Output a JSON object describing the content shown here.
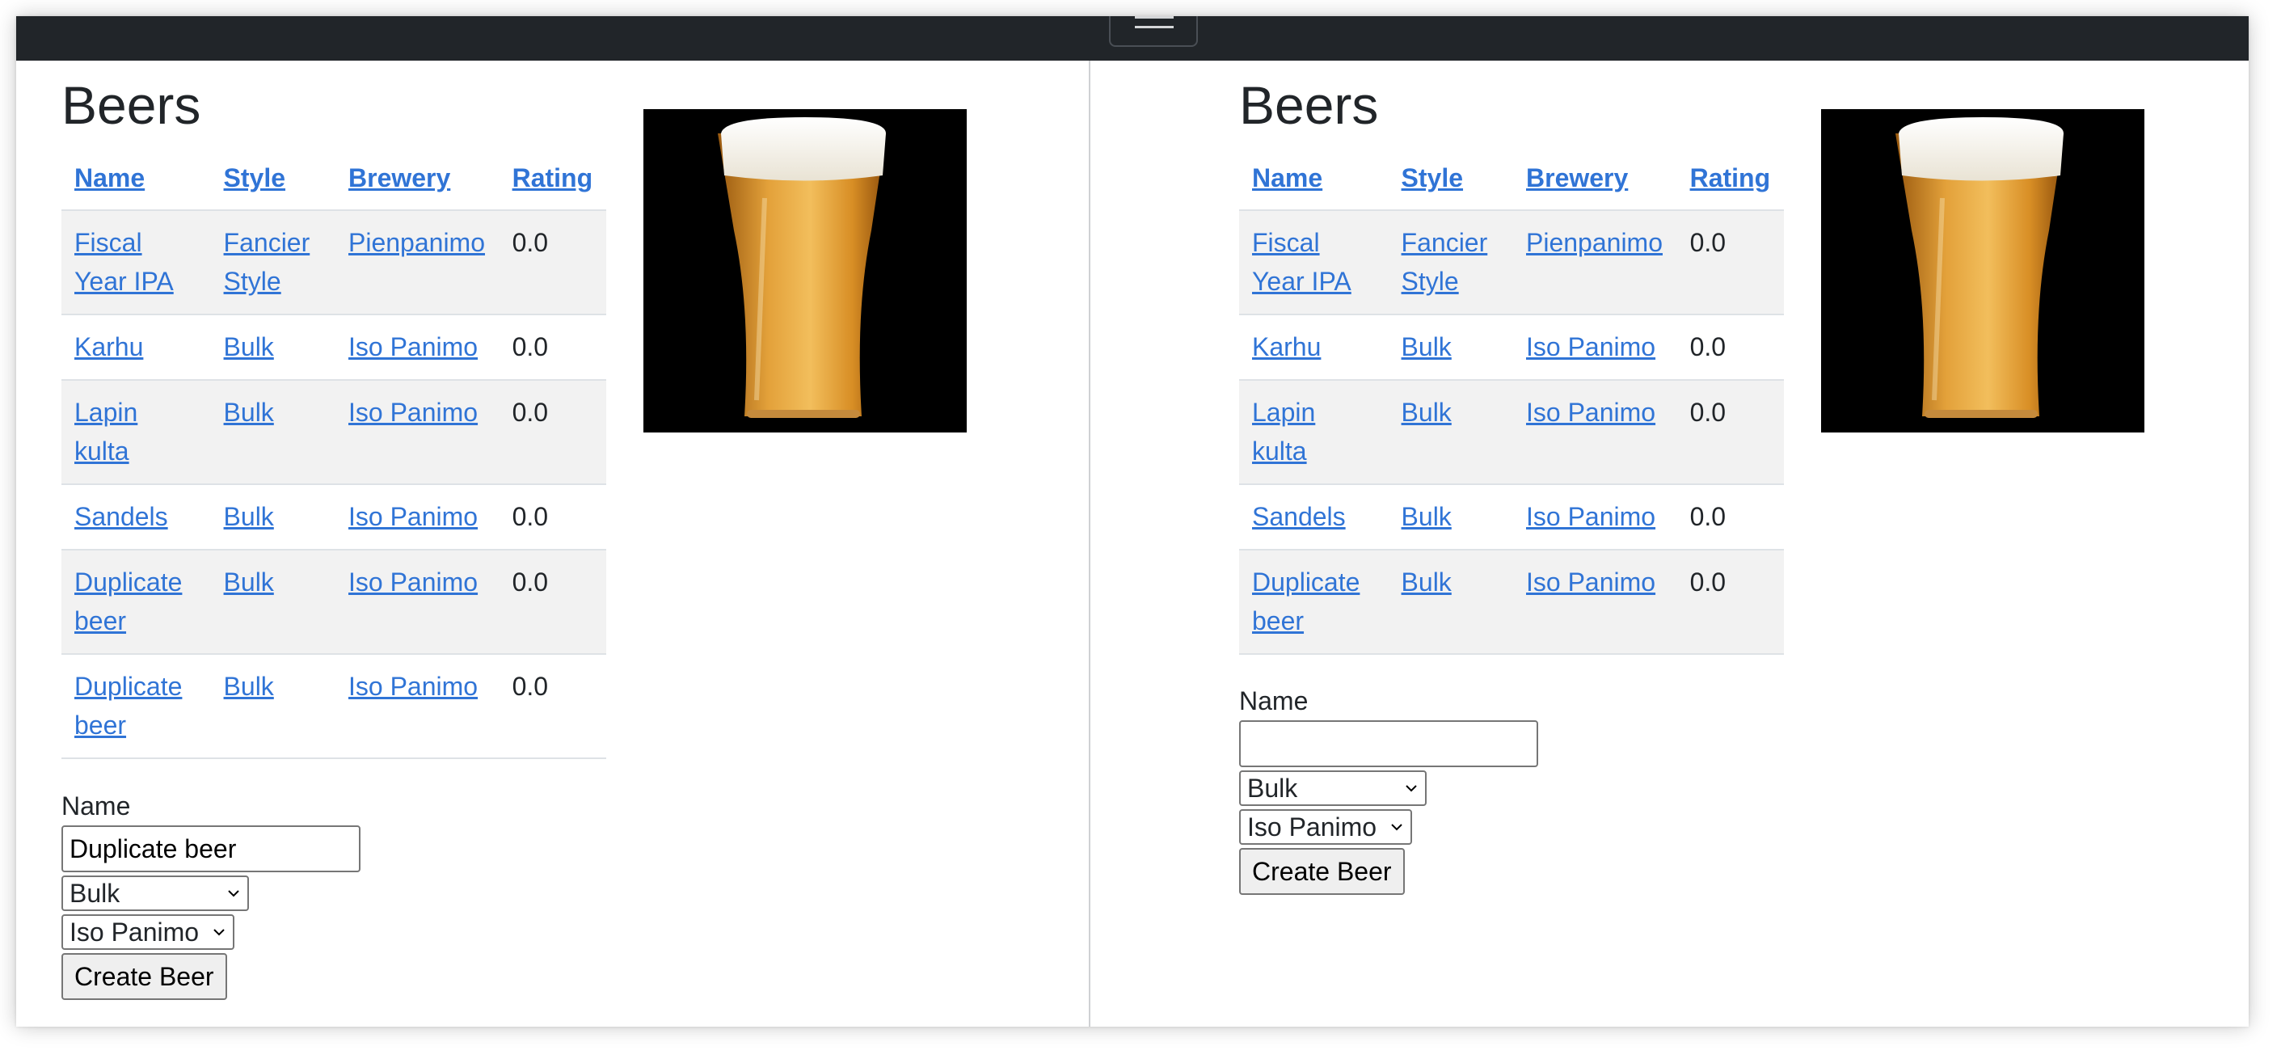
{
  "heading": "Beers",
  "table": {
    "columns": [
      "Name",
      "Style",
      "Brewery",
      "Rating"
    ],
    "rows": [
      {
        "name": "Fiscal Year IPA",
        "style": "Fancier Style",
        "brewery": "Pienpanimo",
        "rating": "0.0"
      },
      {
        "name": "Karhu",
        "style": "Bulk",
        "brewery": "Iso Panimo",
        "rating": "0.0"
      },
      {
        "name": "Lapin kulta",
        "style": "Bulk",
        "brewery": "Iso Panimo",
        "rating": "0.0"
      },
      {
        "name": "Sandels",
        "style": "Bulk",
        "brewery": "Iso Panimo",
        "rating": "0.0"
      },
      {
        "name": "Duplicate beer",
        "style": "Bulk",
        "brewery": "Iso Panimo",
        "rating": "0.0"
      },
      {
        "name": "Duplicate beer",
        "style": "Bulk",
        "brewery": "Iso Panimo",
        "rating": "0.0"
      }
    ]
  },
  "right_table": {
    "rows": [
      {
        "name": "Fiscal Year IPA",
        "style": "Fancier Style",
        "brewery": "Pienpanimo",
        "rating": "0.0"
      },
      {
        "name": "Karhu",
        "style": "Bulk",
        "brewery": "Iso Panimo",
        "rating": "0.0"
      },
      {
        "name": "Lapin kulta",
        "style": "Bulk",
        "brewery": "Iso Panimo",
        "rating": "0.0"
      },
      {
        "name": "Sandels",
        "style": "Bulk",
        "brewery": "Iso Panimo",
        "rating": "0.0"
      },
      {
        "name": "Duplicate beer",
        "style": "Bulk",
        "brewery": "Iso Panimo",
        "rating": "0.0"
      }
    ]
  },
  "form": {
    "name_label": "Name",
    "style_value": "Bulk",
    "brewery_value": "Iso Panimo",
    "submit_label": "Create Beer"
  },
  "left_form": {
    "name_value": "Duplicate beer"
  },
  "right_form": {
    "name_value": ""
  },
  "icons": {
    "menu": "hamburger-icon",
    "dropdown": "chevron-down-icon",
    "beer_image": "beer-glass-image"
  },
  "colors": {
    "navbar": "#212529",
    "link": "#3074d6",
    "striped_row": "#f2f2f2",
    "text": "#212529"
  }
}
